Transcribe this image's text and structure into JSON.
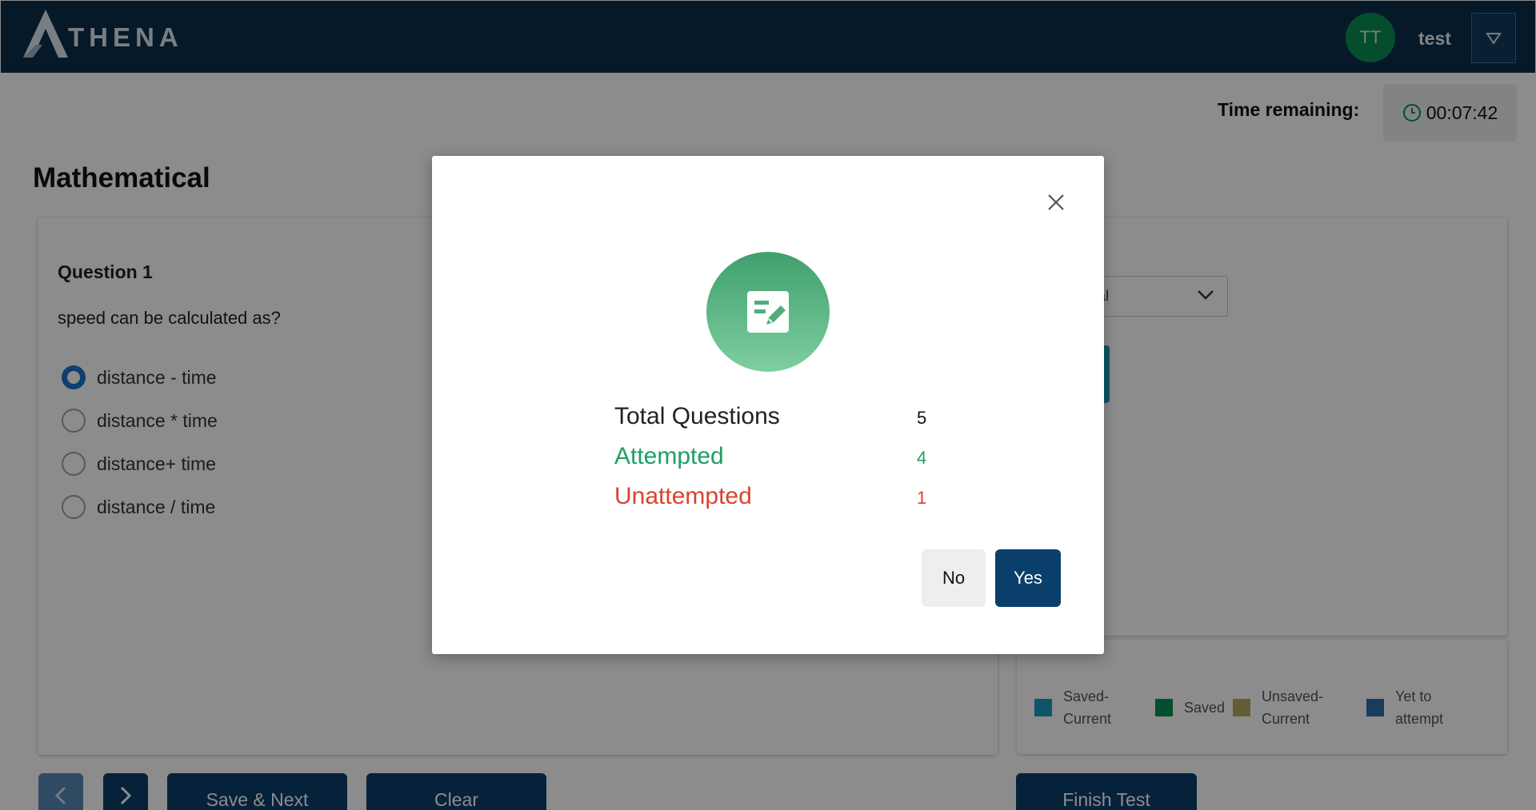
{
  "header": {
    "logo_text": "THENA",
    "logo_letter": "A",
    "avatar_initials": "TT",
    "username": "test"
  },
  "timer": {
    "label": "Time remaining:",
    "value": "00:07:42"
  },
  "section_title": "Mathematical",
  "question": {
    "label": "Question 1",
    "text": "speed can be calculated as?",
    "options": [
      {
        "label": "distance - time",
        "selected": true
      },
      {
        "label": "distance * time",
        "selected": false
      },
      {
        "label": "distance+ time",
        "selected": false
      },
      {
        "label": "distance / time",
        "selected": false
      }
    ]
  },
  "section_select": {
    "value": "ematical"
  },
  "legend": [
    {
      "label": "Saved-\nCurrent",
      "color": "#1a9bc0"
    },
    {
      "label": "Saved",
      "color": "#0a8f53"
    },
    {
      "label": "Unsaved-\nCurrent",
      "color": "#b6a95a"
    },
    {
      "label": "Yet to\nattempt",
      "color": "#2f6ea8"
    }
  ],
  "buttons": {
    "save_next": "Save & Next",
    "clear": "Clear",
    "finish_test": "Finish Test"
  },
  "modal": {
    "rows": [
      {
        "label": "Total Questions",
        "value": "5",
        "color": "#111111"
      },
      {
        "label": "Attempted",
        "value": "4",
        "color": "#1e9e63"
      },
      {
        "label": "Unattempted",
        "value": "1",
        "color": "#d9432f"
      }
    ],
    "no_label": "No",
    "yes_label": "Yes"
  }
}
